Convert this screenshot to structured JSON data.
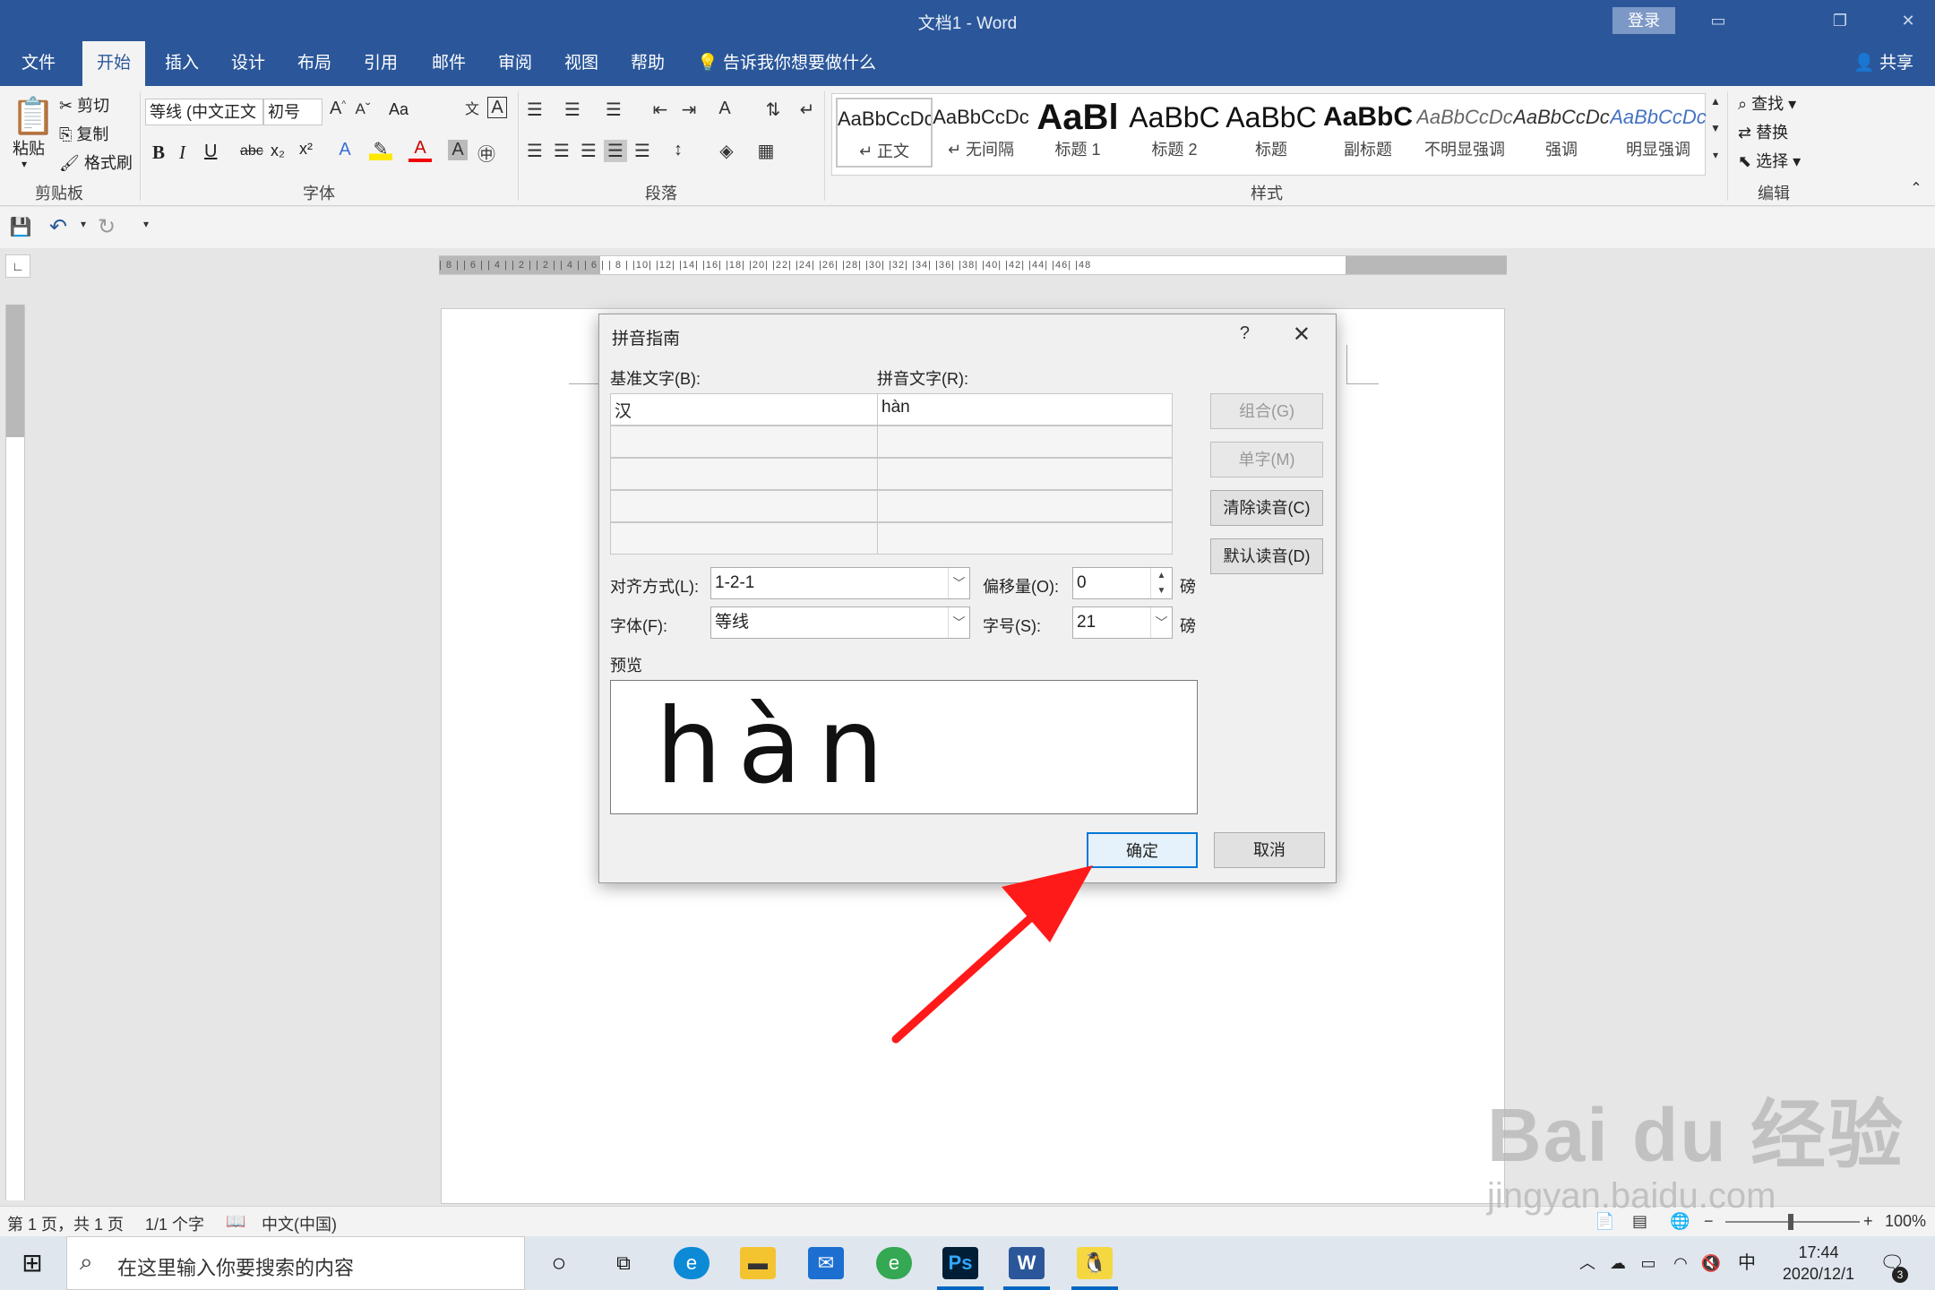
{
  "window": {
    "title": "文档1 - Word",
    "login": "登录",
    "share": "共享",
    "colors": {
      "accent": "#2b579a",
      "dialog_primary": "#0078d7",
      "arrow": "#ff1a1a"
    }
  },
  "tabs": [
    "文件",
    "开始",
    "插入",
    "设计",
    "布局",
    "引用",
    "邮件",
    "审阅",
    "视图",
    "帮助"
  ],
  "active_tab": "开始",
  "tell_me": "告诉我你想要做什么",
  "ribbon": {
    "clipboard": {
      "label": "剪贴板",
      "paste": "粘贴",
      "cut": "剪切",
      "copy": "复制",
      "format_painter": "格式刷"
    },
    "font": {
      "label": "字体",
      "font_name": "等线 (中文正文",
      "font_size": "初号",
      "change_case": "Aa",
      "bold": "B",
      "italic": "I",
      "underline": "U",
      "strike": "abc",
      "sub": "x₂",
      "sup": "x²"
    },
    "paragraph": {
      "label": "段落"
    },
    "styles": {
      "label": "样式",
      "items": [
        {
          "sample": "AaBbCcDc",
          "name": "↵ 正文"
        },
        {
          "sample": "AaBbCcDc",
          "name": "↵ 无间隔"
        },
        {
          "sample": "AaBl",
          "name": "标题 1"
        },
        {
          "sample": "AaBbC",
          "name": "标题 2"
        },
        {
          "sample": "AaBbC",
          "name": "标题"
        },
        {
          "sample": "AaBbC",
          "name": "副标题"
        },
        {
          "sample": "AaBbCcDc",
          "name": "不明显强调"
        },
        {
          "sample": "AaBbCcDc",
          "name": "强调"
        },
        {
          "sample": "AaBbCcDc",
          "name": "明显强调"
        }
      ]
    },
    "editing": {
      "label": "编辑",
      "find": "查找",
      "replace": "替换",
      "select": "选择"
    }
  },
  "ruler": {
    "horizontal": "| 8 |  | 6 |  | 4 |  | 2 |      | 2 |  | 4 |  | 6 |  | 8 |  |10|  |12|  |14|  |16|  |18|  |20|  |22|  |24|  |26|  |28|  |30|  |32|  |34|  |36|  |38|  |40|  |42|  |44|  |46|  |48"
  },
  "dialog": {
    "title": "拼音指南",
    "help": "?",
    "base_text_label": "基准文字(B):",
    "ruby_text_label": "拼音文字(R):",
    "rows": [
      {
        "base": "汉",
        "ruby": "hàn"
      },
      {
        "base": "",
        "ruby": ""
      },
      {
        "base": "",
        "ruby": ""
      },
      {
        "base": "",
        "ruby": ""
      },
      {
        "base": "",
        "ruby": ""
      }
    ],
    "buttons": {
      "group": "组合(G)",
      "mono": "单字(M)",
      "clear": "清除读音(C)",
      "default": "默认读音(D)",
      "ok": "确定",
      "cancel": "取消"
    },
    "alignment_label": "对齐方式(L):",
    "alignment_value": "1-2-1",
    "offset_label": "偏移量(O):",
    "offset_value": "0",
    "offset_unit": "磅",
    "font_label": "字体(F):",
    "font_value": "等线",
    "size_label": "字号(S):",
    "size_value": "21",
    "size_unit": "磅",
    "preview_label": "预览",
    "preview_text": "hàn"
  },
  "status": {
    "page": "第 1 页，共 1 页",
    "words": "1/1 个字",
    "language": "中文(中国)",
    "zoom": "100%"
  },
  "taskbar": {
    "search_placeholder": "在这里输入你要搜索的内容",
    "time": "17:44",
    "date": "2020/12/1",
    "ime": "中",
    "notification_count": "3"
  },
  "watermark": {
    "brand": "Bai du 经验",
    "url": "jingyan.baidu.com"
  }
}
